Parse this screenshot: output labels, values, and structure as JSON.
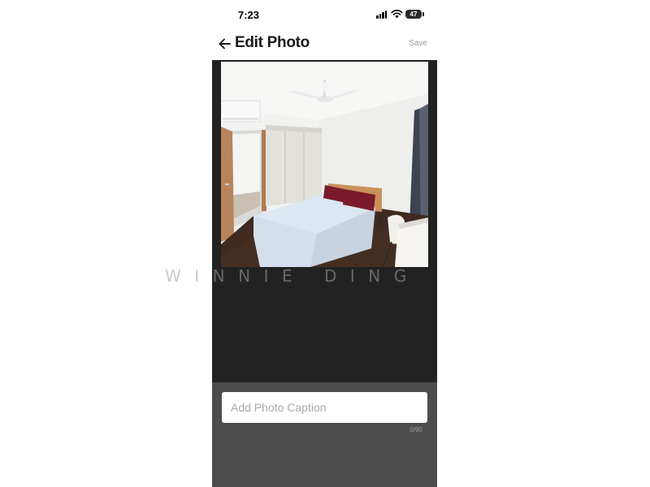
{
  "status_bar": {
    "time": "7:23",
    "battery": "47"
  },
  "header": {
    "title": "Edit Photo",
    "save_label": "Save",
    "back_icon": "arrow-left-icon"
  },
  "photo": {
    "watermark": "WINNIE DING",
    "subject": "bedroom"
  },
  "caption": {
    "placeholder": "Add Photo Caption",
    "value": "",
    "counter": "0/90"
  },
  "colors": {
    "editor_bg": "#222222",
    "caption_bg": "#4d4d4d",
    "save_text": "#9a9a9a",
    "headboard": "#c9915a",
    "pillows": "#7a1a2a"
  }
}
